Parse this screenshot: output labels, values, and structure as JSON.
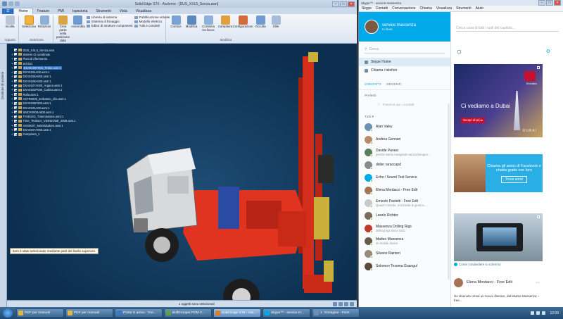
{
  "solid_edge": {
    "title": "Solid Edge ST6 - Assieme - [DUS_XXL5_Senza.asm]",
    "tabs": [
      "Home",
      "Feature",
      "PMI",
      "Ispeziona",
      "Strumenti",
      "Vista",
      "Visualizza"
    ],
    "ribbon_groups": [
      {
        "label": "Appunti",
        "buttons": [
          "Incolla"
        ]
      },
      {
        "label": "Selezione",
        "buttons": [
          "Seleziona",
          "Relazioni"
        ]
      },
      {
        "label": "Assieme",
        "buttons": [
          "Crea parte nella posizione data",
          "Assembla"
        ],
        "small": [
          "Libreria di sistema",
          "Sistema di fissaggio",
          "Editor di strutture componenti",
          "Pubblicazione virtuale",
          "Modello elettrico",
          "Tubi e condotti"
        ]
      },
      {
        "label": "Modifica",
        "buttons": [
          "Cornice",
          "Modifica",
          "Combina tra facce",
          "Campitura",
          "Configurazioni",
          "Occulta",
          "Stile"
        ]
      }
    ],
    "sidebar_label": "Gestione di assiemi",
    "tree": [
      {
        "name": "DUS_XXL5_Senza.asm",
        "selected": false
      },
      {
        "name": "Sistemi di coordinate",
        "selected": false
      },
      {
        "name": "Piani di riferimento",
        "selected": false
      },
      {
        "name": "Schizzi",
        "selected": false
      },
      {
        "name": "DXA0105T000_Telaio.asm:1",
        "selected": true
      },
      {
        "name": "DXA0104A00.asm:1",
        "selected": false
      },
      {
        "name": "DXA0105A000.asm:1",
        "selected": false
      },
      {
        "name": "DXA0106A000.asm:1",
        "selected": false
      },
      {
        "name": "DXA0107A000_Argano.asm:1",
        "selected": false
      },
      {
        "name": "DXA0102P000_Cabina.asm:1",
        "selected": false
      },
      {
        "name": "Ralla.asm:1",
        "selected": false
      },
      {
        "name": "ASTR0046_serbatoio_olio.asm:1",
        "selected": false
      },
      {
        "name": "DXA0105F000.asm:1",
        "selected": false
      },
      {
        "name": "DXA0104A00.asm:1",
        "selected": false
      },
      {
        "name": "SMCR0000A000.asm:1",
        "selected": false
      },
      {
        "name": "TAVB10G_Trasmissione.asm:1",
        "selected": false
      },
      {
        "name": "Time_Tedesco_VERSIONE_2009.asm:1",
        "selected": false
      },
      {
        "name": "ASS0007_Motoriduttore.asm:1",
        "selected": false
      },
      {
        "name": "DXA0107A000.asm:1",
        "selected": false
      },
      {
        "name": "Campitura_1",
        "selected": false
      }
    ],
    "tooltip": "Item è stato selezionato mediante parti del livello superiore.",
    "status": "1 oggetti sono selezionati"
  },
  "skype": {
    "title": "Skype™ - service.massenza",
    "menu": [
      "Skype",
      "Contatti",
      "Conversazione",
      "Chiama",
      "Visualizza",
      "Strumenti",
      "Aiuto"
    ],
    "user": {
      "name": "service.massenza",
      "status": "In linea"
    },
    "search_placeholder": "Cerca",
    "nav": [
      "Skype Home",
      "Chiama i telefoni"
    ],
    "tabs": [
      "CONTATTI",
      "RECENTI"
    ],
    "favorites_label": "Preferiti",
    "favorites_hint": "Trascina qui i contatti",
    "all_label": "Tutti",
    "contacts": [
      {
        "name": "Alan Valey",
        "mood": "",
        "color": "#6b8fb5"
      },
      {
        "name": "Andrea Gennari",
        "mood": "",
        "color": "#b88a6a"
      },
      {
        "name": "Davide Pavesi",
        "mood": "perché siamo navigando senza bisogno...",
        "color": "#5a7f5a"
      },
      {
        "name": "didier raraccapd",
        "mood": "",
        "color": "#8a8a8a"
      },
      {
        "name": "Echo / Sound Test Service",
        "mood": "",
        "color": "#00a9e8"
      },
      {
        "name": "Elena Mordacci - Free Edit",
        "mood": "",
        "color": "#a67358"
      },
      {
        "name": "Ernesto Paoletti - Free Edit",
        "mood": "Quanto casade, si richiede le giusti a...",
        "color": "#c9c9c9"
      },
      {
        "name": "Laszlo Richter",
        "mood": "",
        "color": "#7a6a5a"
      },
      {
        "name": "Massenza Drilling Rigs",
        "mood": "Drilling rigs since 1921",
        "color": "#c0392b"
      },
      {
        "name": "Matteo Massenza",
        "mood": "on mobile device",
        "color": "#6a5a4a"
      },
      {
        "name": "Silvano Rainieri",
        "mood": "",
        "color": "#9a8a7a"
      },
      {
        "name": "Solomon Tesema Guangul",
        "mood": "",
        "color": "#5a4a3a"
      }
    ],
    "address_placeholder": "Cerca cosa di tutti i ruoli del capitolo...",
    "ad1": {
      "headline": "Ci vediamo a Dubai",
      "cta": "Scopri di più ▸",
      "caption": "Emirates",
      "city": "DUBAI"
    },
    "ad2": {
      "headline": "Chiama gli amici di Facebook e chatta gratis con loro",
      "cta": "Trova amici"
    },
    "ad3_caption": "Come condividere lo schermo",
    "post": {
      "name": "Elena Mordacci - Free Edit",
      "body": "Ho divenuto ormai un nuovo liberare, dal letame Massenza – free...",
      "footer": "1 h fa su Skype"
    }
  },
  "taskbar": {
    "items": [
      {
        "label": "PDF per manuali",
        "color": "#e0b64a",
        "active": false
      },
      {
        "label": "PDF per manuali",
        "color": "#e0b64a",
        "active": false
      },
      {
        "label": "Posta in arrivo - Out...",
        "color": "#3a78c2",
        "active": false
      },
      {
        "label": "BullGroupet POM X...",
        "color": "#5aa34a",
        "active": false
      },
      {
        "label": "Solid Edge ST6 - Ass...",
        "color": "#e37b2f",
        "active": true
      },
      {
        "label": "Skype™ - service.m...",
        "color": "#00a9e8",
        "active": false
      },
      {
        "label": "1. Immagine - Paint",
        "color": "#6f8fb9",
        "active": false
      }
    ],
    "clock": "12:09"
  }
}
